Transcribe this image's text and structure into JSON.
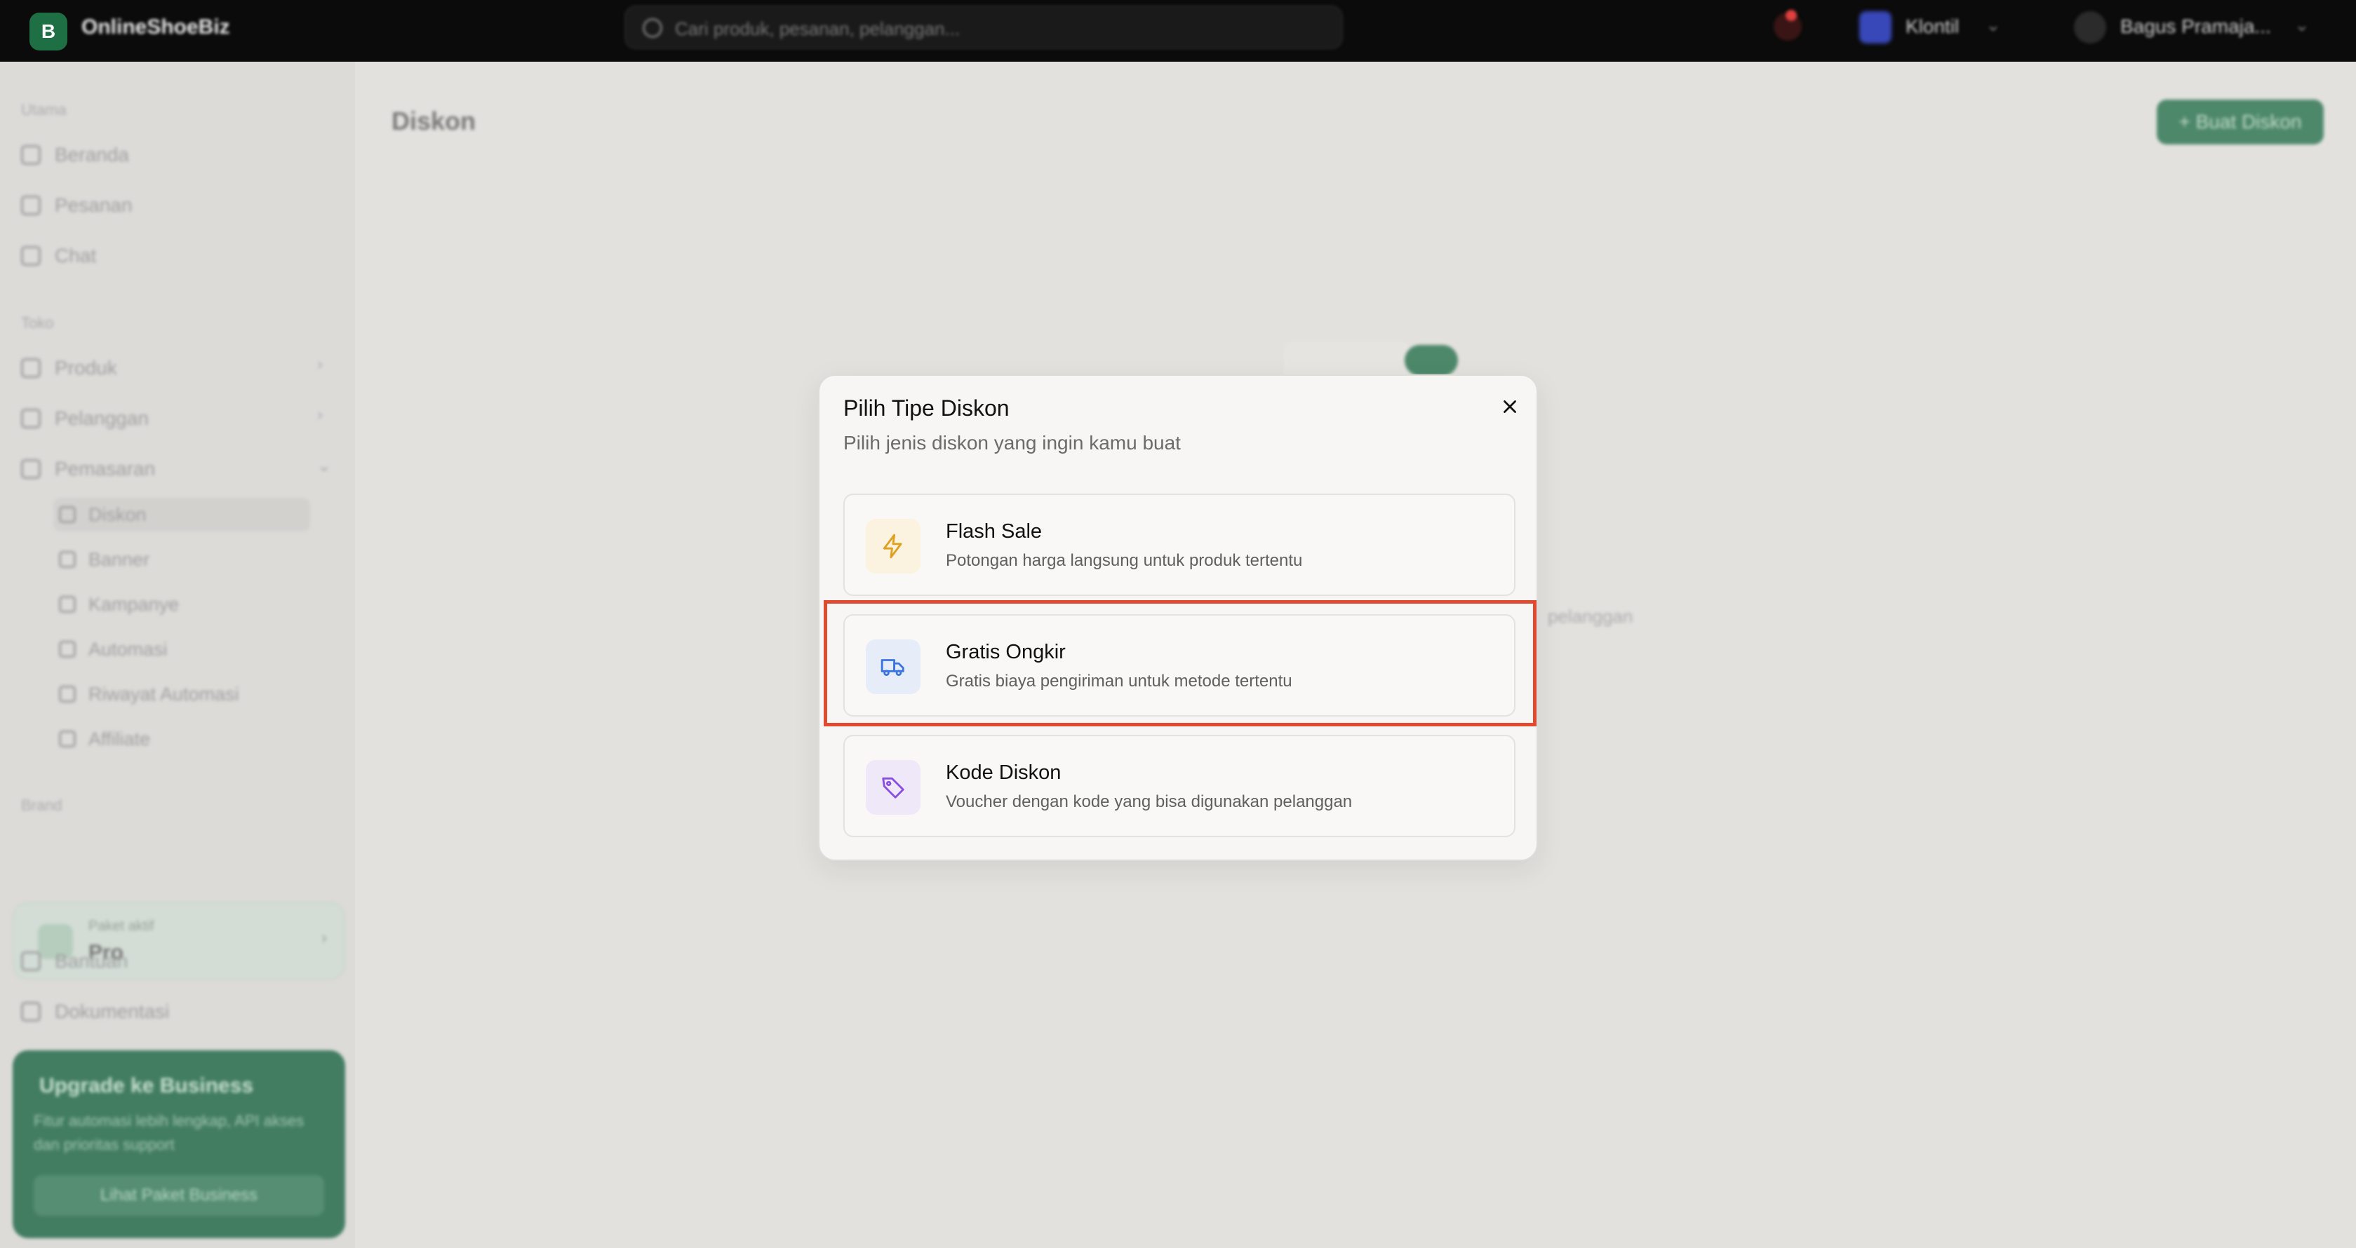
{
  "topbar": {
    "logo_letter": "B",
    "brand": "OnlineShoeBiz",
    "search_placeholder": "Cari produk, pesanan, pelanggan...",
    "store_name": "Klontil",
    "user_name": "Bagus Pramaja..."
  },
  "sidebar": {
    "section_main": "Utama",
    "nav_home": "Beranda",
    "nav_orders": "Pesanan",
    "nav_chat": "Chat",
    "section_store": "Toko",
    "nav_products": "Produk",
    "nav_customers": "Pelanggan",
    "nav_marketing": "Pemasaran",
    "sub_items": [
      "Diskon",
      "Banner",
      "Kampanye",
      "Automasi",
      "Riwayat Automasi",
      "Affiliate"
    ],
    "section_brand": "Brand",
    "plan_small": "Paket aktif",
    "plan_name": "Pro",
    "nav_help": "Bantuan",
    "nav_docs": "Dokumentasi",
    "upgrade_title": "Upgrade ke Business",
    "upgrade_desc": "Fitur automasi lebih lengkap, API akses dan prioritas support",
    "upgrade_button": "Lihat Paket Business"
  },
  "main": {
    "page_title": "Diskon",
    "create_button": "+ Buat Diskon",
    "empty_text": "pelanggan"
  },
  "modal": {
    "title": "Pilih Tipe Diskon",
    "subtitle": "Pilih jenis diskon yang ingin kamu buat",
    "options": [
      {
        "title": "Flash Sale",
        "desc": "Potongan harga langsung untuk produk tertentu",
        "icon": "lightning-icon",
        "color": "#e0a020",
        "bg": "#fbf3df"
      },
      {
        "title": "Gratis Ongkir",
        "desc": "Gratis biaya pengiriman untuk metode tertentu",
        "icon": "truck-icon",
        "color": "#3b74e0",
        "bg": "#e6edf9"
      },
      {
        "title": "Kode Diskon",
        "desc": "Voucher dengan kode yang bisa digunakan pelanggan",
        "icon": "tag-icon",
        "color": "#8a4fe0",
        "bg": "#efe8f9"
      }
    ]
  },
  "colors": {
    "accent": "#1d6b44",
    "highlight": "#e04a30"
  }
}
